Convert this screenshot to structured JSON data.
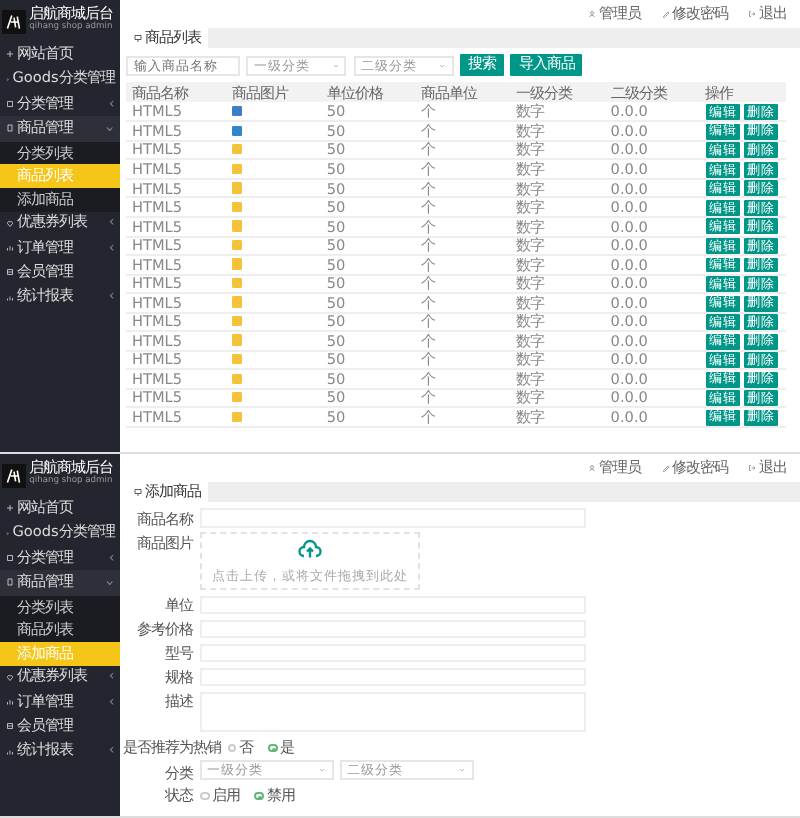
{
  "screens": [
    {
      "sidebar": {
        "title": "启航商城后台",
        "subtitle": "qihang shop admin",
        "items": [
          {
            "label": "网站首页"
          },
          {
            "label": "Goods分类管理"
          },
          {
            "label": "分类管理",
            "expanded": false,
            "caret": "‹"
          },
          {
            "label": "商品管理",
            "expanded": true,
            "caret": "‹",
            "children": [
              {
                "label": "分类列表",
                "selected": false
              },
              {
                "label": "商品列表",
                "selected": true
              },
              {
                "label": "添加商品",
                "selected": false
              }
            ]
          },
          {
            "label": "优惠券列表",
            "expanded": false,
            "caret": "‹"
          },
          {
            "label": "订单管理",
            "expanded": false,
            "caret": "‹"
          },
          {
            "label": "会员管理"
          },
          {
            "label": "统计报表",
            "expanded": false,
            "caret": "‹"
          }
        ]
      },
      "header": {
        "links": [
          "管理员",
          "修改密码",
          "退出"
        ]
      },
      "tab": "商品列表",
      "filters": {
        "search_placeholder": "输入商品名称",
        "select_1": "一级分类",
        "select_2": "二级分类",
        "buttons": [
          "搜索",
          "导入商品"
        ]
      },
      "table": {
        "columns": [
          "商品名称",
          "商品图片",
          "单位价格",
          "商品单位",
          "一级分类",
          "二级分类",
          "操作"
        ],
        "rows": [
          {
            "name": "HTML5",
            "color": "#3d7fc4",
            "price": "50",
            "unit": "个",
            "cat1": "数字",
            "cat2": "0.0.0",
            "actions": [
              "编辑",
              "删除"
            ]
          },
          {
            "name": "HTML5",
            "color": "#2f86c9",
            "price": "50",
            "unit": "个",
            "cat1": "数字",
            "cat2": "0.0.0",
            "actions": [
              "编辑",
              "删除"
            ]
          },
          {
            "name": "HTML5",
            "color": "#f5c33b",
            "price": "50",
            "unit": "个",
            "cat1": "数字",
            "cat2": "0.0.0",
            "actions": [
              "编辑",
              "删除"
            ]
          },
          {
            "name": "HTML5",
            "color": "#f5c33b",
            "price": "50",
            "unit": "个",
            "cat1": "数字",
            "cat2": "0.0.0",
            "actions": [
              "编辑",
              "删除"
            ]
          },
          {
            "name": "HTML5",
            "color": "#f5c33b",
            "price": "50",
            "unit": "个",
            "cat1": "数字",
            "cat2": "0.0.0",
            "actions": [
              "编辑",
              "删除"
            ]
          },
          {
            "name": "HTML5",
            "color": "#f5c33b",
            "price": "50",
            "unit": "个",
            "cat1": "数字",
            "cat2": "0.0.0",
            "actions": [
              "编辑",
              "删除"
            ]
          },
          {
            "name": "HTML5",
            "color": "#f5c33b",
            "price": "50",
            "unit": "个",
            "cat1": "数字",
            "cat2": "0.0.0",
            "actions": [
              "编辑",
              "删除"
            ]
          },
          {
            "name": "HTML5",
            "color": "#f5c33b",
            "price": "50",
            "unit": "个",
            "cat1": "数字",
            "cat2": "0.0.0",
            "actions": [
              "编辑",
              "删除"
            ]
          },
          {
            "name": "HTML5",
            "color": "#f5c33b",
            "price": "50",
            "unit": "个",
            "cat1": "数字",
            "cat2": "0.0.0",
            "actions": [
              "编辑",
              "删除"
            ]
          },
          {
            "name": "HTML5",
            "color": "#f5c33b",
            "price": "50",
            "unit": "个",
            "cat1": "数字",
            "cat2": "0.0.0",
            "actions": [
              "编辑",
              "删除"
            ]
          },
          {
            "name": "HTML5",
            "color": "#f5c33b",
            "price": "50",
            "unit": "个",
            "cat1": "数字",
            "cat2": "0.0.0",
            "actions": [
              "编辑",
              "删除"
            ]
          },
          {
            "name": "HTML5",
            "color": "#f5c33b",
            "price": "50",
            "unit": "个",
            "cat1": "数字",
            "cat2": "0.0.0",
            "actions": [
              "编辑",
              "删除"
            ]
          },
          {
            "name": "HTML5",
            "color": "#f5c33b",
            "price": "50",
            "unit": "个",
            "cat1": "数字",
            "cat2": "0.0.0",
            "actions": [
              "编辑",
              "删除"
            ]
          },
          {
            "name": "HTML5",
            "color": "#f5c33b",
            "price": "50",
            "unit": "个",
            "cat1": "数字",
            "cat2": "0.0.0",
            "actions": [
              "编辑",
              "删除"
            ]
          },
          {
            "name": "HTML5",
            "color": "#f5c33b",
            "price": "50",
            "unit": "个",
            "cat1": "数字",
            "cat2": "0.0.0",
            "actions": [
              "编辑",
              "删除"
            ]
          },
          {
            "name": "HTML5",
            "color": "#f5c33b",
            "price": "50",
            "unit": "个",
            "cat1": "数字",
            "cat2": "0.0.0",
            "actions": [
              "编辑",
              "删除"
            ]
          },
          {
            "name": "HTML5",
            "color": "#f5c33b",
            "price": "50",
            "unit": "个",
            "cat1": "数字",
            "cat2": "0.0.0",
            "actions": [
              "编辑",
              "删除"
            ]
          }
        ]
      }
    },
    {
      "sidebar": {
        "title": "启航商城后台",
        "subtitle": "qihang shop admin",
        "items": [
          {
            "label": "网站首页"
          },
          {
            "label": "Goods分类管理"
          },
          {
            "label": "分类管理",
            "expanded": false,
            "caret": "‹"
          },
          {
            "label": "商品管理",
            "expanded": true,
            "caret": "‹",
            "children": [
              {
                "label": "分类列表",
                "selected": false
              },
              {
                "label": "商品列表",
                "selected": false
              },
              {
                "label": "添加商品",
                "selected": true
              }
            ]
          },
          {
            "label": "优惠券列表",
            "expanded": false,
            "caret": "‹"
          },
          {
            "label": "订单管理",
            "expanded": false,
            "caret": "‹"
          },
          {
            "label": "会员管理"
          },
          {
            "label": "统计报表",
            "expanded": false,
            "caret": "‹"
          }
        ]
      },
      "header": {
        "links": [
          "管理员",
          "修改密码",
          "退出"
        ]
      },
      "tab": "添加商品",
      "form": {
        "fields": [
          {
            "kind": "input",
            "label": "商品名称"
          },
          {
            "kind": "upload",
            "label": "商品图片",
            "hint": "点击上传，或将文件拖拽到此处"
          },
          {
            "kind": "input",
            "label": "单位"
          },
          {
            "kind": "input",
            "label": "参考价格"
          },
          {
            "kind": "input",
            "label": "型号"
          },
          {
            "kind": "input",
            "label": "规格"
          },
          {
            "kind": "textarea",
            "label": "描述"
          },
          {
            "kind": "radio",
            "label": "是否推荐为热销",
            "options": [
              {
                "label": "否",
                "selected": false
              },
              {
                "label": "是",
                "selected": true
              }
            ]
          },
          {
            "kind": "selects",
            "label": "分类",
            "options": [
              {
                "label": "一级分类"
              },
              {
                "label": "二级分类"
              }
            ]
          },
          {
            "kind": "radio",
            "label": "状态",
            "options": [
              {
                "label": "启用",
                "selected": false
              },
              {
                "label": "禁用",
                "selected": true
              }
            ]
          }
        ]
      }
    }
  ]
}
